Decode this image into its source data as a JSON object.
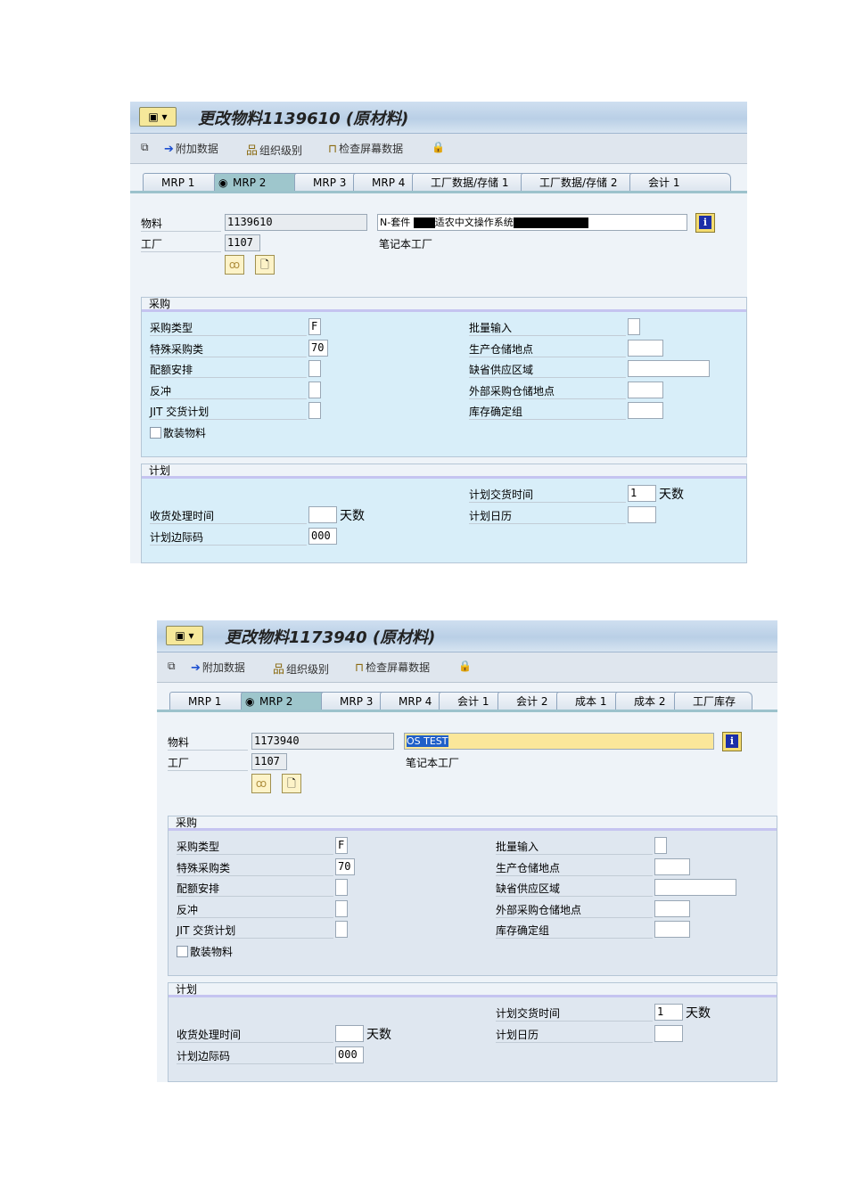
{
  "screens": [
    {
      "title": "更改物料1139610 (原材料)",
      "toolbar": {
        "additional_data": "附加数据",
        "org_levels": "组织级别",
        "check_screen": "检查屏幕数据"
      },
      "tabs": [
        "MRP 1",
        "MRP 2",
        "MRP 3",
        "MRP 4",
        "工厂数据/存储 1",
        "工厂数据/存储 2",
        "会计 1"
      ],
      "active_tab": "MRP 2",
      "header": {
        "material_label": "物料",
        "material": "1139610",
        "description_prefix": "N-套件",
        "description_mid": "适农中文操作系统",
        "plant_label": "工厂",
        "plant": "1107",
        "plant_name": "笔记本工厂"
      },
      "purchasing": {
        "title": "采购",
        "procurement_type_label": "采购类型",
        "procurement_type": "F",
        "special_proc_label": "特殊采购类",
        "special_proc": "70",
        "quota_label": "配额安排",
        "backflush_label": "反冲",
        "jit_label": "JIT 交货计划",
        "bulk_label": "散装物料",
        "batch_entry_label": "批量输入",
        "prod_sloc_label": "生产仓储地点",
        "supply_area_label": "缺省供应区域",
        "ext_sloc_label": "外部采购仓储地点",
        "stock_det_label": "库存确定组"
      },
      "planning": {
        "title": "计划",
        "planned_delivery_label": "计划交货时间",
        "planned_delivery": "1",
        "days": "天数",
        "planning_calendar_label": "计划日历",
        "gr_time_label": "收货处理时间",
        "gr_days": "天数",
        "sm_key_label": "计划边际码",
        "sm_key": "000"
      }
    },
    {
      "title": "更改物料1173940 (原材料)",
      "toolbar": {
        "additional_data": "附加数据",
        "org_levels": "组织级别",
        "check_screen": "检查屏幕数据"
      },
      "tabs": [
        "MRP 1",
        "MRP 2",
        "MRP 3",
        "MRP 4",
        "会计 1",
        "会计 2",
        "成本 1",
        "成本 2",
        "工厂库存"
      ],
      "active_tab": "MRP 2",
      "header": {
        "material_label": "物料",
        "material": "1173940",
        "description": "OS TEST",
        "plant_label": "工厂",
        "plant": "1107",
        "plant_name": "笔记本工厂"
      },
      "purchasing": {
        "title": "采购",
        "procurement_type_label": "采购类型",
        "procurement_type": "F",
        "special_proc_label": "特殊采购类",
        "special_proc": "70",
        "quota_label": "配额安排",
        "backflush_label": "反冲",
        "jit_label": "JIT 交货计划",
        "bulk_label": "散装物料",
        "batch_entry_label": "批量输入",
        "prod_sloc_label": "生产仓储地点",
        "supply_area_label": "缺省供应区域",
        "ext_sloc_label": "外部采购仓储地点",
        "stock_det_label": "库存确定组"
      },
      "planning": {
        "title": "计划",
        "planned_delivery_label": "计划交货时间",
        "planned_delivery": "1",
        "days": "天数",
        "planning_calendar_label": "计划日历",
        "gr_time_label": "收货处理时间",
        "gr_days": "天数",
        "sm_key_label": "计划边际码",
        "sm_key": "000"
      }
    }
  ]
}
